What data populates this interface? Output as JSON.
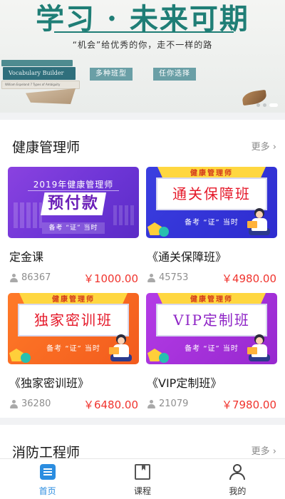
{
  "banner": {
    "headline": "学习 · 未来可期",
    "subline": "“机会”给优秀的你，走不一样的路",
    "book_title": "Vocabulary Builder",
    "book_small": "William Espeland  7 Types of Ambiguity",
    "tag1": "多种班型",
    "tag2": "任你选择"
  },
  "section1": {
    "title": "健康管理师",
    "more": "更多 ›",
    "cards": [
      {
        "thumb_top": "2019年健康管理师",
        "thumb_main": "预付款",
        "thumb_foot": "备考 “证” 当时",
        "title": "定金课",
        "students": "86367",
        "price": "￥1000.00"
      },
      {
        "thumb_top": "健康管理师",
        "thumb_main": "通关保障班",
        "thumb_foot": "备考 “证” 当时",
        "title": "《通关保障班》",
        "students": "45753",
        "price": "￥4980.00"
      },
      {
        "thumb_top": "健康管理师",
        "thumb_main": "独家密训班",
        "thumb_foot": "备考 “证” 当时",
        "title": "《独家密训班》",
        "students": "36280",
        "price": "￥6480.00"
      },
      {
        "thumb_top": "健康管理师",
        "thumb_main": "VIP定制班",
        "thumb_foot": "备考 “证” 当时",
        "title": "《VIP定制班》",
        "students": "21079",
        "price": "￥7980.00"
      }
    ]
  },
  "section2": {
    "title": "消防工程师",
    "more": "更多 ›"
  },
  "tabbar": {
    "home": "首页",
    "course": "课程",
    "me": "我的"
  },
  "colors": {
    "accent": "#2b8de0",
    "price": "#f0342e",
    "banner_teal": "#1f7e76"
  }
}
